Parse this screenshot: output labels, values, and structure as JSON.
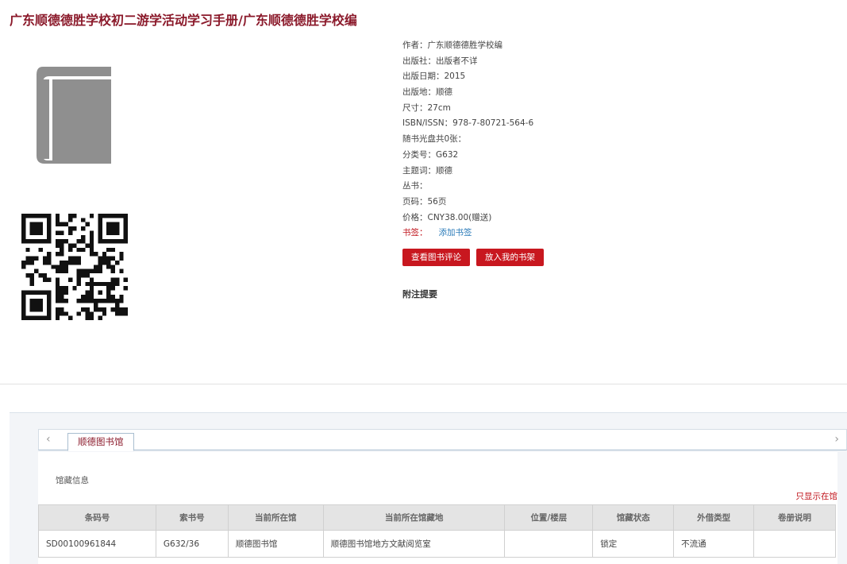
{
  "title": "广东顺德德胜学校初二游学活动学习手册/广东顺德德胜学校编",
  "icons": {
    "cover": "book-cover-icon",
    "qr": "qr-code"
  },
  "meta": {
    "author": {
      "label": "作者：",
      "value": "广东顺德德胜学校编"
    },
    "publisher": {
      "label": "出版社：",
      "value": "出版者不详"
    },
    "pub_date": {
      "label": "出版日期：",
      "value": "2015"
    },
    "pub_place": {
      "label": "出版地：",
      "value": "顺德"
    },
    "size": {
      "label": "尺寸：",
      "value": "27cm"
    },
    "isbn": {
      "label": "ISBN/ISSN：",
      "value": "978-7-80721-564-6"
    },
    "disc": {
      "label": "随书光盘共0张：",
      "value": ""
    },
    "class_no": {
      "label": "分类号：",
      "value": "G632"
    },
    "subject": {
      "label": "主题词：",
      "value": "顺德"
    },
    "series": {
      "label": "丛书：",
      "value": ""
    },
    "pages": {
      "label": "页码：",
      "value": "56页"
    },
    "price": {
      "label": "价格：",
      "value": "CNY38.00(赠送)"
    },
    "bookmark": {
      "label": "书签：",
      "link": "添加书签"
    }
  },
  "buttons": {
    "reviews": "查看图书评论",
    "shelf": "放入我的书架"
  },
  "abstract_label": "附注提要",
  "tabs": {
    "left_arrow": "‹",
    "right_arrow": "›",
    "library": "顺德图书馆"
  },
  "holdings": {
    "label": "馆藏信息",
    "only_available": "只显示在馆",
    "columns": [
      "条码号",
      "索书号",
      "当前所在馆",
      "当前所在馆藏地",
      "位置/楼层",
      "馆藏状态",
      "外借类型",
      "卷册说明"
    ],
    "rows": [
      [
        "SD00100961844",
        "G632/36",
        "顺德图书馆",
        "顺德图书馆地方文献阅览室",
        "",
        "锁定",
        "不流通",
        ""
      ]
    ]
  },
  "colors": {
    "title": "#8b1a2b",
    "button": "#c8171f",
    "link": "#2a7ab8",
    "alert": "#c0141c"
  }
}
